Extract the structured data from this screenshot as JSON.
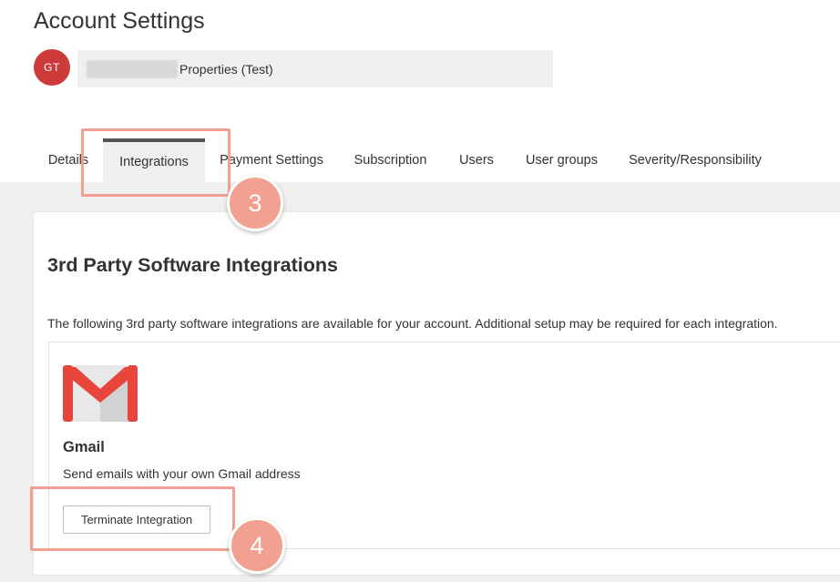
{
  "page": {
    "title": "Account Settings"
  },
  "account": {
    "initials": "GT",
    "name_visible": "Properties (Test)",
    "avatar_color": "#cc3a3a"
  },
  "tabs": [
    {
      "label": "Details",
      "active": false
    },
    {
      "label": "Integrations",
      "active": true
    },
    {
      "label": "Payment Settings",
      "active": false
    },
    {
      "label": "Subscription",
      "active": false
    },
    {
      "label": "Users",
      "active": false
    },
    {
      "label": "User groups",
      "active": false
    },
    {
      "label": "Severity/Responsibility",
      "active": false
    }
  ],
  "section": {
    "title": "3rd Party Software Integrations",
    "description": "The following 3rd party software integrations are available for your account. Additional setup may be required for each integration."
  },
  "integration": {
    "name": "Gmail",
    "description": "Send emails with your own Gmail address",
    "button_label": "Terminate Integration",
    "logo_icon": "gmail-icon"
  },
  "annotations": {
    "step_3": "3",
    "step_4": "4",
    "highlight_color": "#f3a092"
  }
}
